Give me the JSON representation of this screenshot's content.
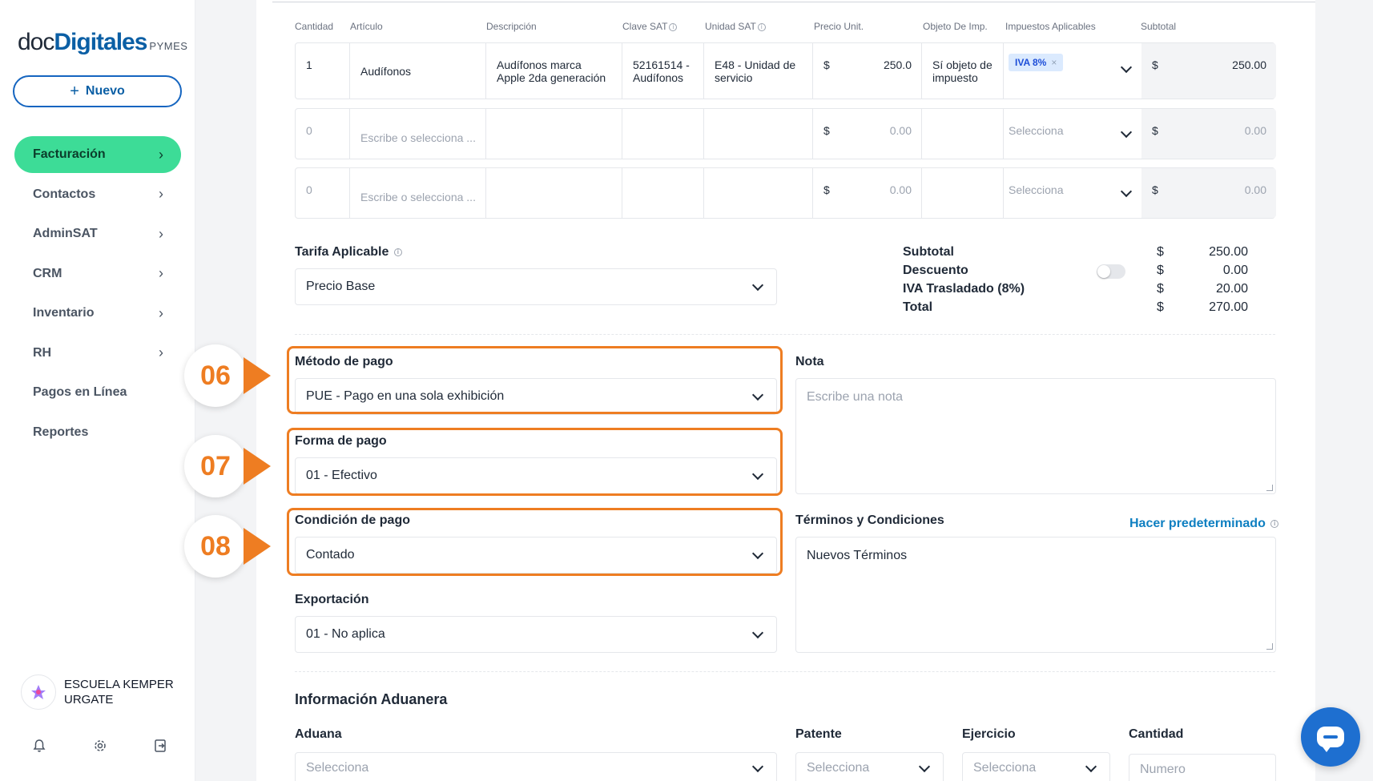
{
  "sidebar": {
    "logo_doc": "doc",
    "logo_digitales": "Digitales",
    "logo_pymes": "PYMES",
    "new_button": "Nuevo",
    "nav": [
      {
        "label": "Facturación",
        "active": true
      },
      {
        "label": "Contactos"
      },
      {
        "label": "AdminSAT"
      },
      {
        "label": "CRM"
      },
      {
        "label": "Inventario"
      },
      {
        "label": "RH"
      },
      {
        "label": "Pagos en Línea"
      },
      {
        "label": "Reportes"
      }
    ],
    "org_name_line1": "ESCUELA KEMPER",
    "org_name_line2": "URGATE"
  },
  "table": {
    "headers": [
      "Cantidad",
      "Artículo",
      "Descripción",
      "Clave SAT",
      "Unidad SAT",
      "Precio Unit.",
      "Objeto De Imp.",
      "Impuestos Aplicables",
      "Subtotal"
    ],
    "rows": [
      {
        "cantidad": "1",
        "articulo": "Audífonos",
        "descripcion_1": "Audífonos marca",
        "descripcion_2": "Apple 2da generación",
        "clave_1": "52161514 -",
        "clave_2": "Audífonos",
        "unidad_1": "E48 - Unidad de",
        "unidad_2": "servicio",
        "currency": "$",
        "precio": "250.0",
        "objeto_1": "Sí objeto de",
        "objeto_2": "impuesto",
        "impuesto_chip": "IVA 8%",
        "subtotal": "250.00"
      },
      {
        "cantidad": "0",
        "articulo_placeholder": "Escribe o selecciona ...",
        "currency": "$",
        "precio": "0.00",
        "impuesto_placeholder": "Selecciona",
        "subtotal": "0.00"
      },
      {
        "cantidad": "0",
        "articulo_placeholder": "Escribe o selecciona ...",
        "currency": "$",
        "precio": "0.00",
        "impuesto_placeholder": "Selecciona",
        "subtotal": "0.00"
      }
    ]
  },
  "tarifa": {
    "label": "Tarifa Aplicable",
    "value": "Precio Base"
  },
  "totals": {
    "currency": "$",
    "subtotal_label": "Subtotal",
    "subtotal": "250.00",
    "descuento_label": "Descuento",
    "descuento": "0.00",
    "iva_label": "IVA Trasladado (8%)",
    "iva": "20.00",
    "total_label": "Total",
    "total": "270.00"
  },
  "metodo_pago": {
    "step": "06",
    "label": "Método de pago",
    "value": "PUE - Pago en una sola exhibición"
  },
  "forma_pago": {
    "step": "07",
    "label": "Forma de pago",
    "value": "01 - Efectivo"
  },
  "condicion_pago": {
    "step": "08",
    "label": "Condición de pago",
    "value": "Contado"
  },
  "exportacion": {
    "label": "Exportación",
    "value": "01 - No aplica"
  },
  "nota": {
    "label": "Nota",
    "placeholder": "Escribe una nota"
  },
  "terminos": {
    "label": "Términos y Condiciones",
    "link": "Hacer predeterminado",
    "value": "Nuevos Términos"
  },
  "aduanera": {
    "title": "Información Aduanera",
    "aduana_label": "Aduana",
    "aduana_placeholder": "Selecciona",
    "patente_label": "Patente",
    "patente_placeholder": "Selecciona",
    "ejercicio_label": "Ejercicio",
    "ejercicio_placeholder": "Selecciona",
    "cantidad_label": "Cantidad",
    "cantidad_placeholder": "Numero"
  },
  "colors": {
    "accent_green": "#3ddc97",
    "brand_blue": "#0b5fa5",
    "highlight_orange": "#ee7d22",
    "chat_blue": "#1e6fd0"
  }
}
